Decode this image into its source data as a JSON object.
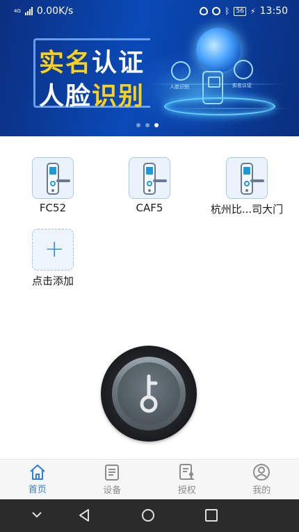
{
  "status_bar": {
    "network_label": "4G",
    "speed": "0.00K/s",
    "battery": "56",
    "time": "13:50"
  },
  "banner": {
    "slogan_line1_part1": "实名",
    "slogan_line1_part2": "认证",
    "slogan_line2_part1": "人脸",
    "slogan_line2_part2": "识别",
    "caption_face": "人脸识别",
    "caption_real": "实名认证",
    "carousel_pages": 3,
    "carousel_active": 3,
    "colors": {
      "yellow": "#ffd21a",
      "blue": "#0a4ab8"
    }
  },
  "devices": [
    {
      "name": "FC52",
      "icon": "door-lock-icon"
    },
    {
      "name": "CAF5",
      "icon": "door-lock-icon"
    },
    {
      "name": "杭州比...司大门",
      "icon": "door-lock-icon"
    }
  ],
  "add_device": {
    "label": "点击添加",
    "icon": "plus-icon"
  },
  "unlock_button": {
    "icon": "key-icon"
  },
  "tabs": [
    {
      "label": "首页",
      "icon": "home-icon",
      "active": true
    },
    {
      "label": "设备",
      "icon": "clipboard-icon",
      "active": false
    },
    {
      "label": "授权",
      "icon": "auth-doc-icon",
      "active": false
    },
    {
      "label": "我的",
      "icon": "user-icon",
      "active": false
    }
  ],
  "accent_color": "#2f7fd8"
}
